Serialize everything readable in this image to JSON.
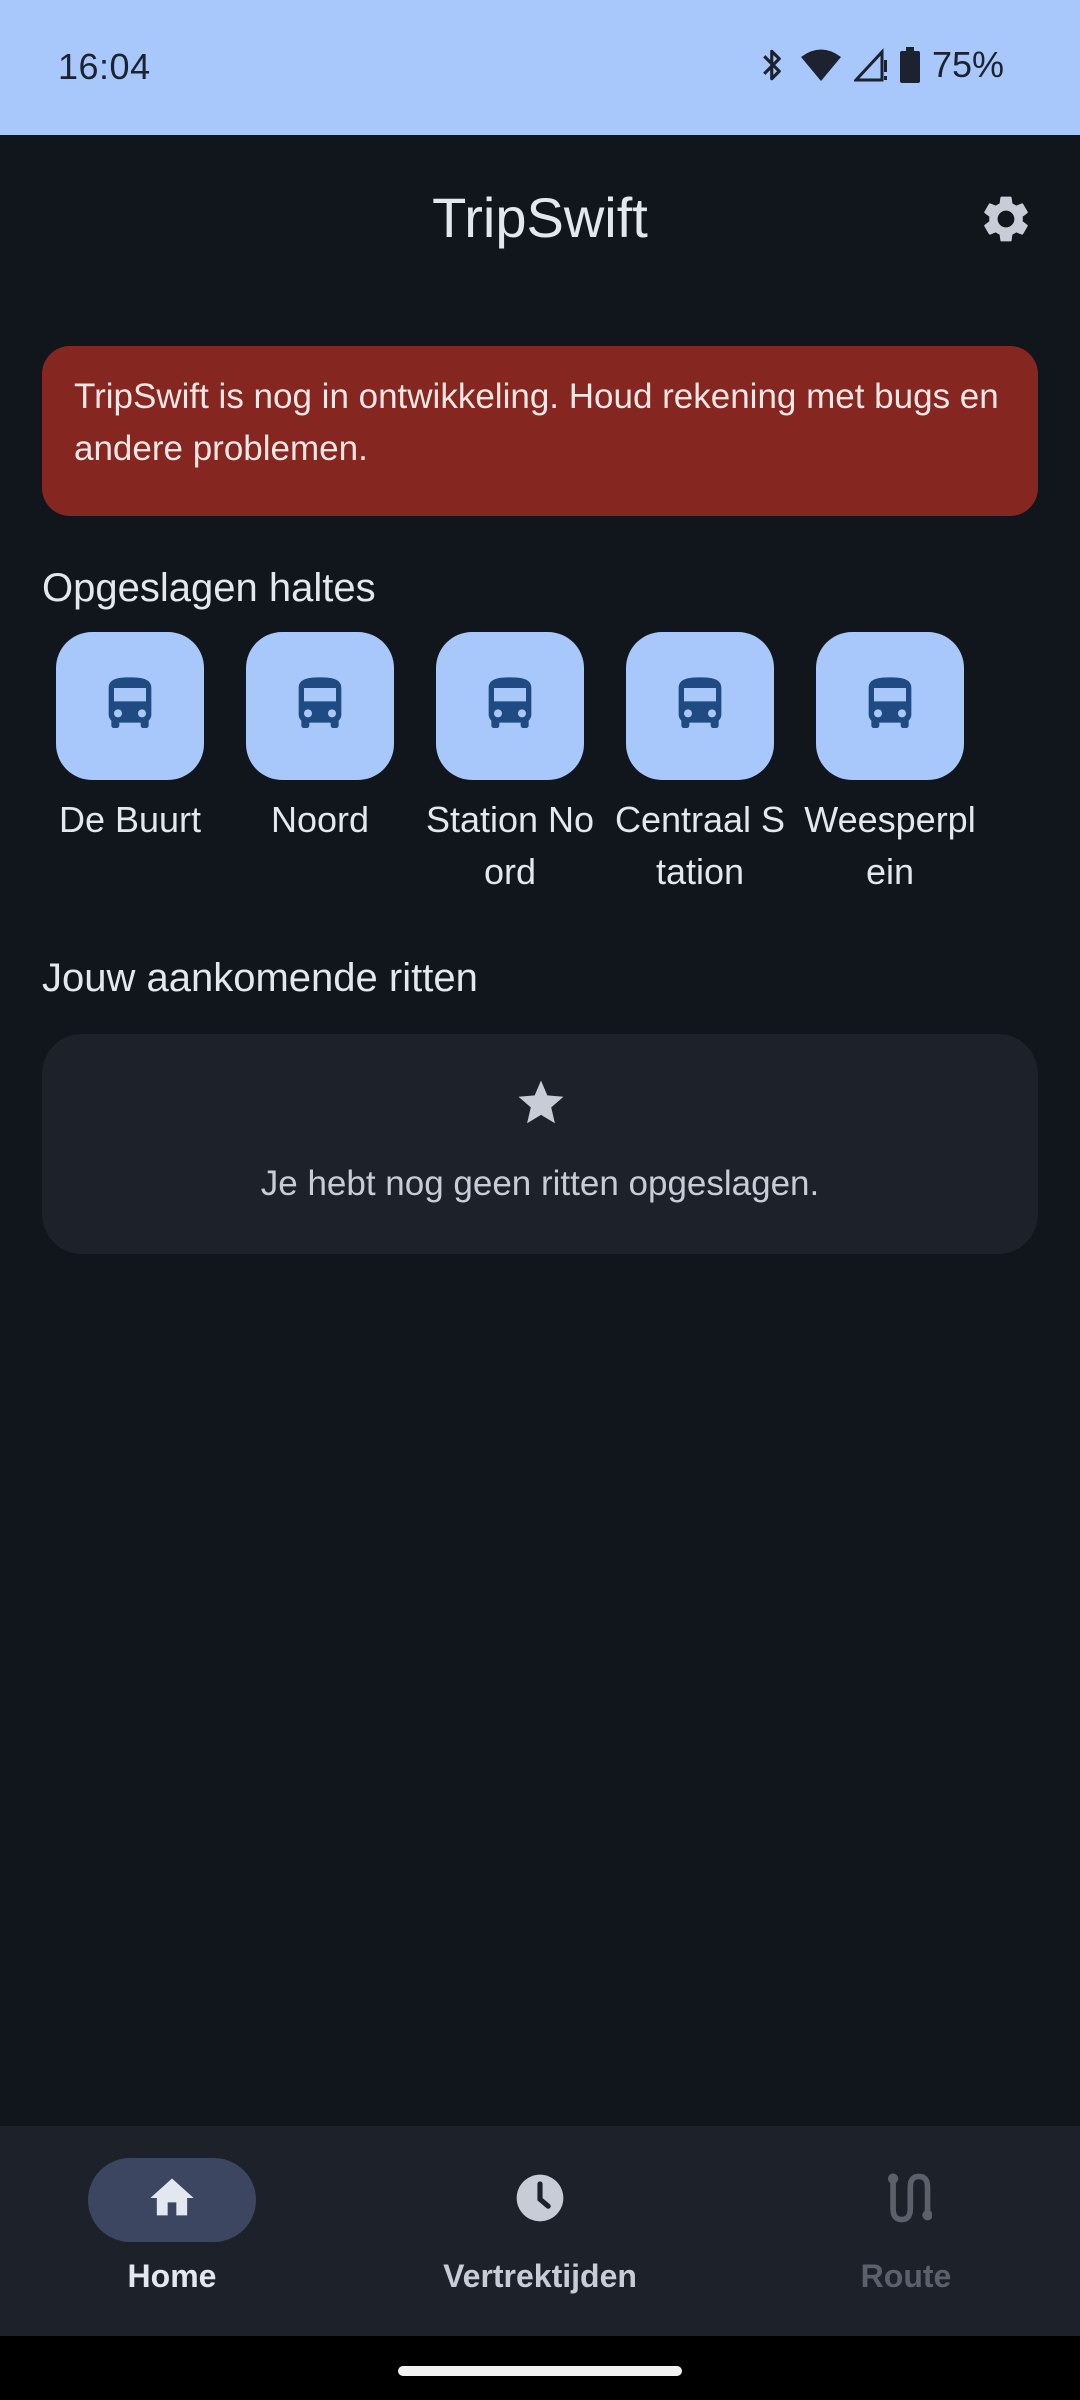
{
  "status_bar": {
    "time": "16:04",
    "battery": "75%",
    "icons": [
      "bluetooth-icon",
      "wifi-icon",
      "signal-icon",
      "battery-icon"
    ]
  },
  "app_bar": {
    "title": "TripSwift",
    "settings_icon": "gear-icon"
  },
  "warning": {
    "text": "TripSwift is nog in ontwikkeling. Houd rekening met bugs en andere problemen.",
    "color": "#852621"
  },
  "saved_stops": {
    "title": "Opgeslagen haltes",
    "items": [
      {
        "label": "De Buurt",
        "icon": "bus-icon"
      },
      {
        "label": "Noord",
        "icon": "bus-icon"
      },
      {
        "label": "Station Noord",
        "icon": "bus-icon"
      },
      {
        "label": "Centraal Station",
        "icon": "bus-icon"
      },
      {
        "label": "Weesperplein",
        "icon": "bus-icon"
      }
    ]
  },
  "upcoming_trips": {
    "title": "Jouw aankomende ritten",
    "empty_text": "Je hebt nog geen ritten opgeslagen.",
    "icon": "star-icon"
  },
  "bottom_nav": {
    "items": [
      {
        "label": "Home",
        "icon": "home-icon",
        "active": true
      },
      {
        "label": "Vertrektijden",
        "icon": "clock-icon",
        "active": false
      },
      {
        "label": "Route",
        "icon": "route-icon",
        "active": false,
        "disabled": true
      }
    ]
  },
  "colors": {
    "background": "#11151c",
    "accent": "#a8c7fa",
    "card": "#1d2129",
    "bus_icon": "#1f4a82"
  }
}
